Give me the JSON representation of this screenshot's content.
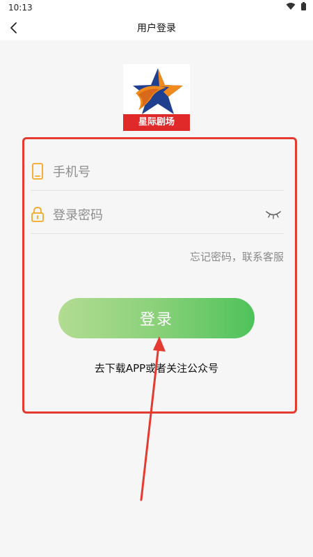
{
  "status_bar": {
    "time": "10:13",
    "wifi_icon": "wifi-icon",
    "battery_icon": "battery-icon"
  },
  "nav": {
    "back_icon": "chevron-left-icon",
    "title": "用户登录"
  },
  "logo": {
    "label": "星际剧场"
  },
  "form": {
    "phone_placeholder": "手机号",
    "phone_value": "",
    "password_placeholder": "登录密码",
    "password_value": "",
    "forgot_text": "忘记密码，联系客服",
    "login_label": "登录",
    "download_tip": "去下载APP或者关注公众号"
  },
  "colors": {
    "accent_orange": "#f5a623",
    "highlight_red": "#e53a2f",
    "button_start": "#b2dc92",
    "button_end": "#4ec25a"
  }
}
